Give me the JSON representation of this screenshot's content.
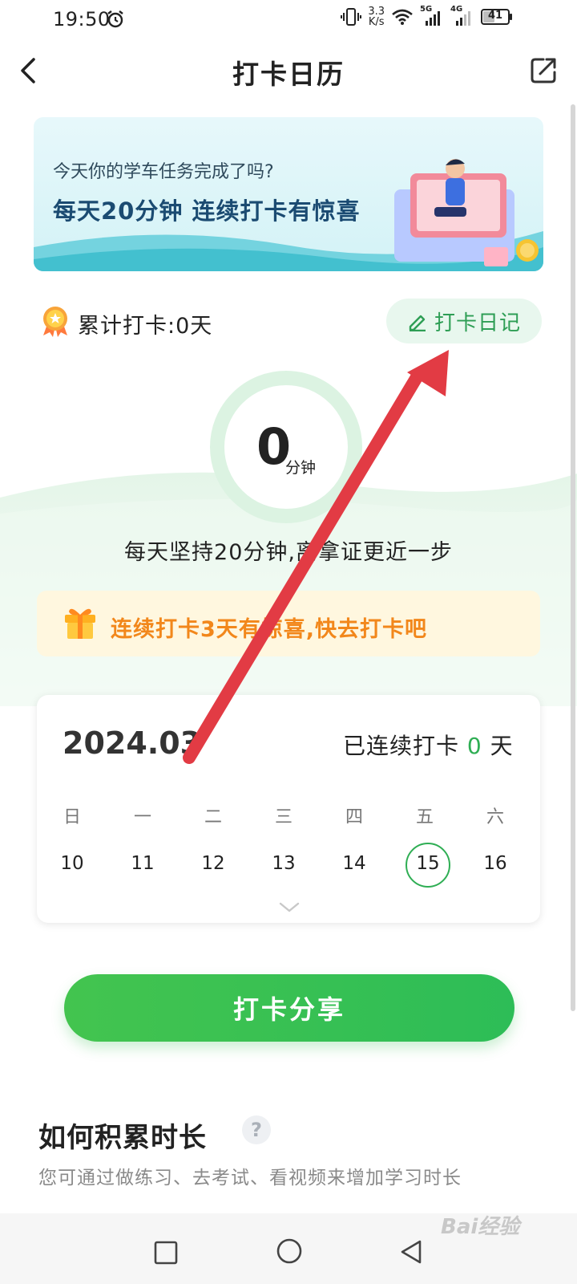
{
  "status_bar": {
    "time": "19:50",
    "net_speed_value": "3.3",
    "net_speed_unit": "K/s",
    "sig1_label": "5G",
    "sig2_label": "4G",
    "battery": "41"
  },
  "header": {
    "title": "打卡日历"
  },
  "banner": {
    "question": "今天你的学车任务完成了吗?",
    "headline": "每天20分钟  连续打卡有惊喜"
  },
  "summary": {
    "total_label": "累计打卡:0天",
    "diary_button": "打卡日记"
  },
  "progress": {
    "minutes": "0",
    "unit": "分钟",
    "motto": "每天坚持20分钟,离拿证更近一步"
  },
  "promo": {
    "text": "连续打卡3天有惊喜,快去打卡吧"
  },
  "calendar": {
    "month": "2024.03",
    "streak_prefix": "已连续打卡",
    "streak_value": "0",
    "streak_suffix": "天",
    "weekdays": [
      "日",
      "一",
      "二",
      "三",
      "四",
      "五",
      "六"
    ],
    "days": [
      "10",
      "11",
      "12",
      "13",
      "14",
      "15",
      "16"
    ],
    "today": "15"
  },
  "share_button": "打卡分享",
  "accumulate": {
    "title": "如何积累时长",
    "help_glyph": "?",
    "subtitle": "您可通过做练习、去考试、看视频来增加学习时长"
  },
  "watermark": "Bai经验",
  "colors": {
    "accent_green": "#2fae54",
    "promo_orange": "#f2871b",
    "arrow_red": "#e23b44"
  }
}
